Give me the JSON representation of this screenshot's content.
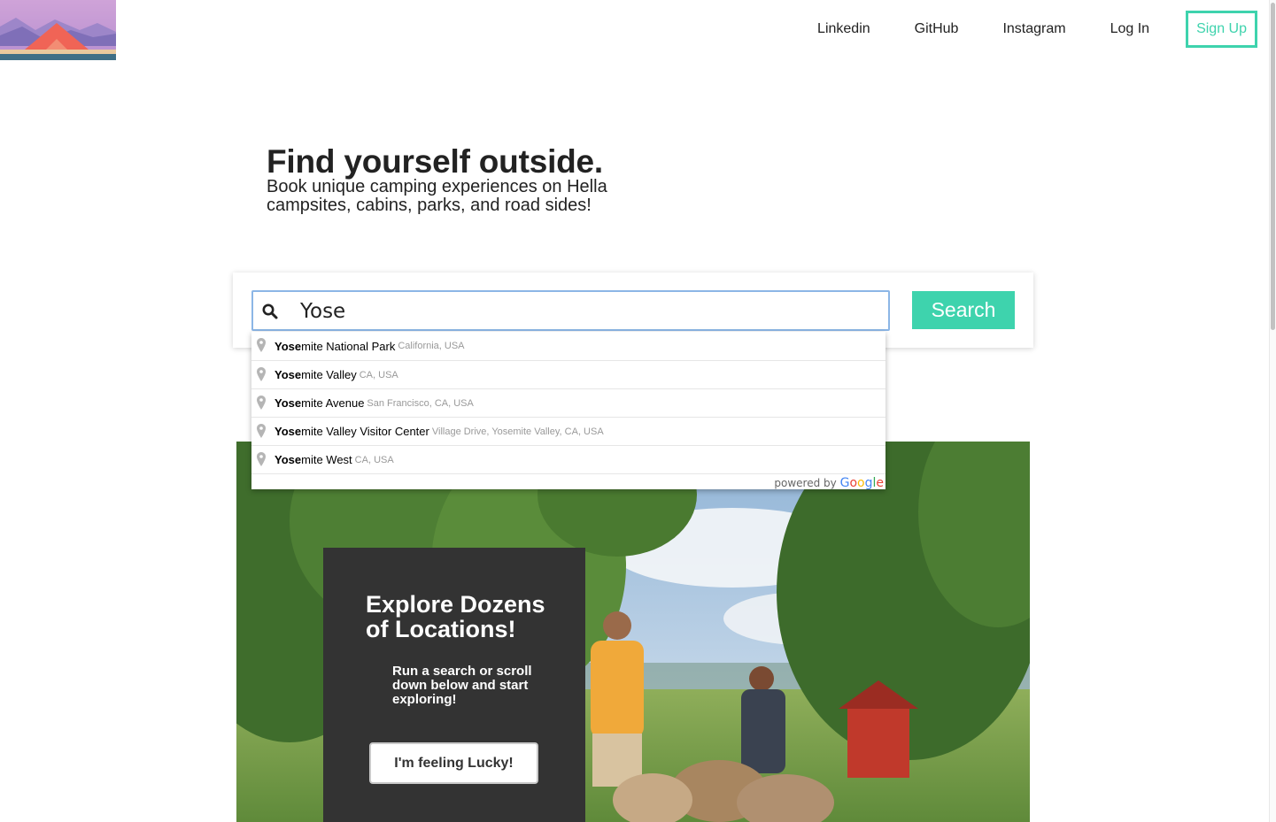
{
  "header": {
    "logo_icon": "mountain-tent-logo",
    "nav": {
      "linkedin": "Linkedin",
      "github": "GitHub",
      "instagram": "Instagram",
      "login": "Log In",
      "signup": "Sign Up"
    }
  },
  "hero": {
    "title": "Find yourself outside.",
    "subtitle": "Book unique camping experiences on Hella campsites, cabins, parks, and road sides!"
  },
  "search": {
    "icon": "search-icon",
    "value": "Yose",
    "button_label": "Search",
    "accent_color": "#3ed3ad"
  },
  "autocomplete": {
    "items": [
      {
        "match": "Yose",
        "rest": "mite National Park",
        "secondary": "California, USA"
      },
      {
        "match": "Yose",
        "rest": "mite Valley",
        "secondary": "CA, USA"
      },
      {
        "match": "Yose",
        "rest": "mite Avenue",
        "secondary": "San Francisco, CA, USA"
      },
      {
        "match": "Yose",
        "rest": "mite Valley Visitor Center",
        "secondary": "Village Drive, Yosemite Valley, CA, USA"
      },
      {
        "match": "Yose",
        "rest": "mite West",
        "secondary": "CA, USA"
      }
    ],
    "powered_by": "powered by",
    "google": [
      "G",
      "o",
      "o",
      "g",
      "l",
      "e"
    ]
  },
  "promo": {
    "title": "Explore Dozens of Locations!",
    "text": "Run a search or scroll down below and start exploring!",
    "button_label": "I'm feeling Lucky!"
  }
}
